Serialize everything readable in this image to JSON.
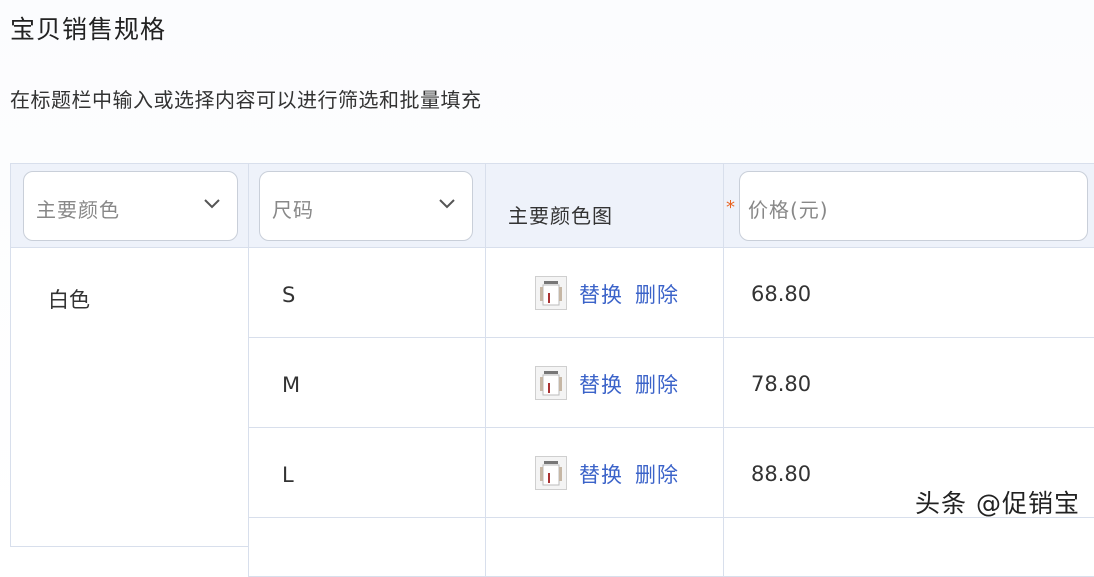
{
  "section": {
    "title": "宝贝销售规格",
    "hint": "在标题栏中输入或选择内容可以进行筛选和批量填充"
  },
  "table": {
    "headers": {
      "color_select_label": "主要颜色",
      "size_select_label": "尺码",
      "color_image_label": "主要颜色图",
      "required_mark": "*",
      "price_placeholder": "价格(元)"
    },
    "color_group": "白色",
    "rows": [
      {
        "size": "S",
        "replace": "替换",
        "delete": "删除",
        "price": "68.80"
      },
      {
        "size": "M",
        "replace": "替换",
        "delete": "删除",
        "price": "78.80"
      },
      {
        "size": "L",
        "replace": "替换",
        "delete": "删除",
        "price": "88.80"
      }
    ]
  },
  "watermark": {
    "text": "头条 @促销宝"
  },
  "colors": {
    "link": "#3b63c9",
    "header_bg": "#eef2fa",
    "border": "#d8dfec",
    "required": "#e8621f"
  },
  "icons": {
    "chevron": "chevron-down-icon",
    "thumbnail": "shirt-thumbnail-icon"
  }
}
